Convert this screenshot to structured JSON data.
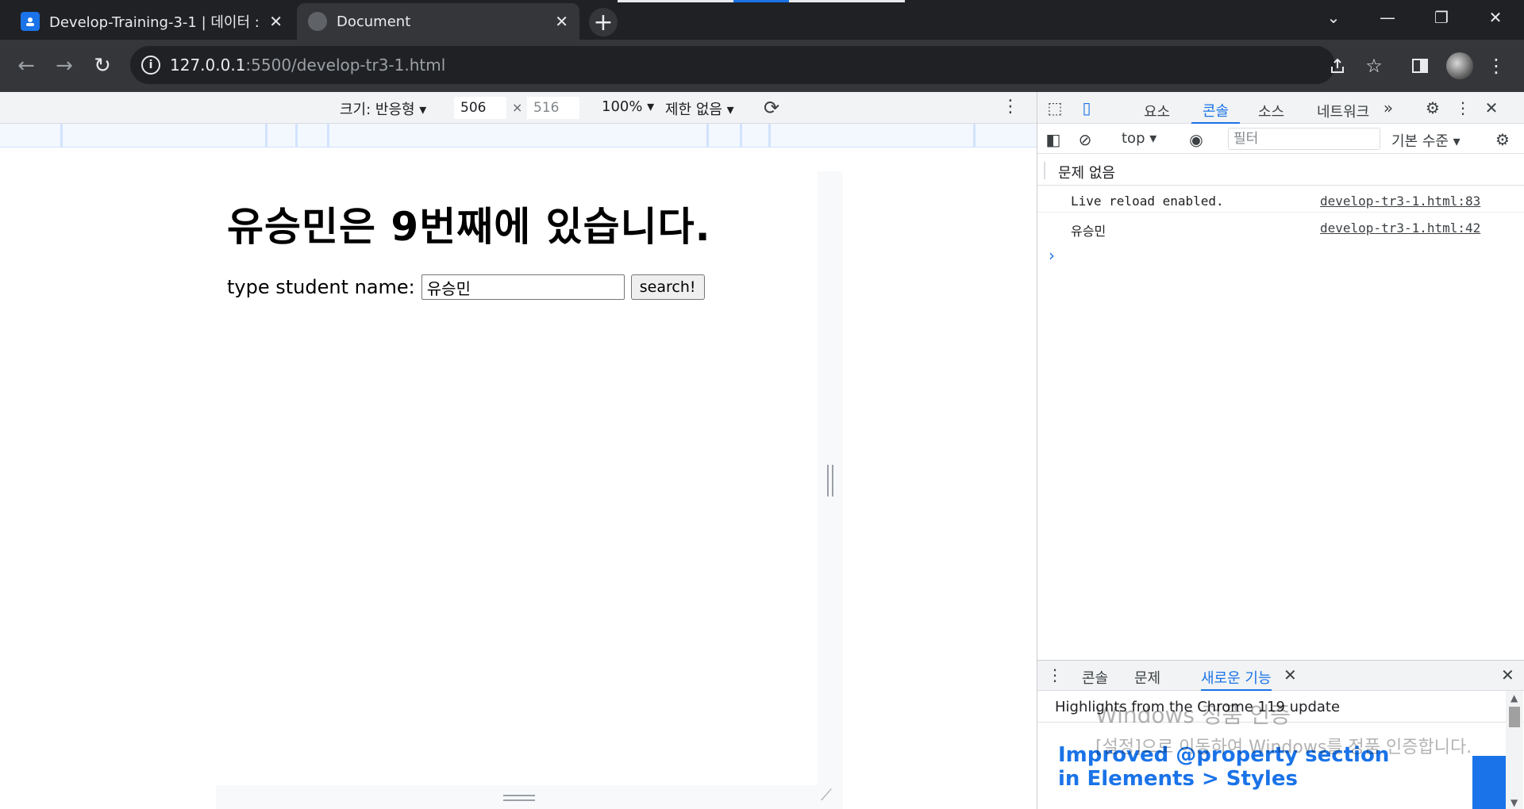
{
  "browser": {
    "tabs": [
      {
        "title": "Develop-Training-3-1 | 데이터 :",
        "icon": "classroom-icon",
        "active": false
      },
      {
        "title": "Document",
        "icon": "globe-icon",
        "active": true
      }
    ],
    "new_tab_symbol": "+",
    "window_controls": [
      "⌄",
      "—",
      "❐",
      "✕"
    ],
    "url_host": "127.0.0.1",
    "url_path": ":5500/develop-tr3-1.html"
  },
  "device_toolbar": {
    "size_label": "크기: 반응형 ▾",
    "width": "506",
    "height": "516",
    "times": "×",
    "zoom": "100% ▾",
    "throttle": "제한 없음 ▾"
  },
  "page": {
    "heading": "유승민은 9번째에 있습니다.",
    "input_label": "type student name:",
    "input_value": "유승민",
    "button_label": "search!"
  },
  "devtools": {
    "tabs": [
      "요소",
      "콘솔",
      "소스",
      "네트워크"
    ],
    "active_tab": "콘솔",
    "more": "»",
    "context": "top ▾",
    "filter_placeholder": "필터",
    "level": "기본 수준 ▾",
    "issues": "문제 없음",
    "messages": [
      {
        "text": "Live reload enabled.",
        "source": "develop-tr3-1.html:83"
      },
      {
        "text": "유승민",
        "source": "develop-tr3-1.html:42"
      }
    ],
    "prompt": "›",
    "drawer_tabs": [
      "콘솔",
      "문제",
      "새로운 기능"
    ],
    "drawer_active": "새로운 기능",
    "highlights": "Highlights from the Chrome 119 update",
    "feature_title": "Improved @property section in Elements > Styles"
  },
  "watermark": {
    "line1": "Windows 정품 인증",
    "line2": "[설정]으로 이동하여 Windows를 정품 인증합니다."
  },
  "colors": {
    "accent": "#1a73e8",
    "chrome_dark": "#202124",
    "chrome_mid": "#35363a"
  }
}
